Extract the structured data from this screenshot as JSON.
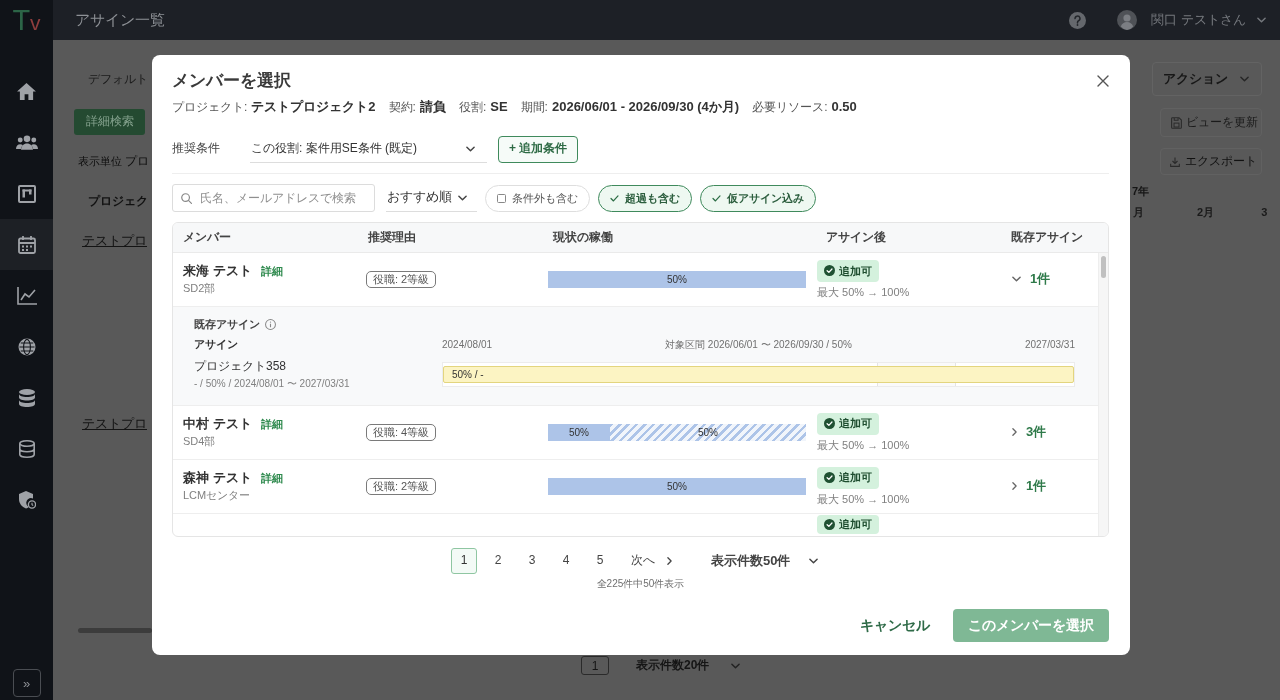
{
  "sidebar": {
    "logo": "Tv",
    "items": [
      {
        "selected": false
      },
      {
        "selected": false
      },
      {
        "selected": false
      },
      {
        "selected": true
      },
      {
        "selected": false
      },
      {
        "selected": false
      },
      {
        "selected": false
      },
      {
        "selected": false
      },
      {
        "selected": false
      }
    ],
    "expand_button": "»"
  },
  "header": {
    "title": "アサイン一覧",
    "user": "関口 テストさん"
  },
  "page": {
    "view": "デフォルト",
    "search_button": "詳細検索",
    "unit_label": "表示単位",
    "unit_value": "プロ",
    "column": "プロジェク",
    "links": [
      "テストプロ",
      "テストプロ"
    ],
    "action_menu": "アクション",
    "update_view": "ビューを更新",
    "export": "エクスポート",
    "year": "7年",
    "months": [
      "月",
      "2月",
      "3"
    ],
    "pagination": {
      "page": "1",
      "page_size": "表示件数20件"
    }
  },
  "dialog": {
    "title": "メンバーを選択",
    "meta": [
      {
        "label": "プロジェクト:",
        "value": "テストプロジェクト2"
      },
      {
        "label": "契約:",
        "value": "請負"
      },
      {
        "label": "役割:",
        "value": "SE"
      },
      {
        "label": "期間:",
        "value": "2026/06/01 - 2026/09/30 (4か月)"
      },
      {
        "label": "必要リソース:",
        "value": "0.50"
      }
    ],
    "criteria": {
      "label": "推奨条件",
      "value": "この役割: 案件用SE条件 (既定)",
      "add_button": "+ 追加条件"
    },
    "search": {
      "placeholder": "氏名、メールアドレスで検索"
    },
    "sort": "おすすめ順",
    "filters": [
      {
        "label": "条件外も含む",
        "checked": false
      },
      {
        "label": "超過も含む",
        "checked": true
      },
      {
        "label": "仮アサイン込み",
        "checked": true
      }
    ],
    "table": {
      "columns": [
        "メンバー",
        "推奨理由",
        "現状の稼働",
        "アサイン後",
        "既存アサイン"
      ],
      "rows": [
        {
          "name": "来海 テスト",
          "detail": "詳細",
          "department": "SD2部",
          "reason": "役職: 2等級",
          "workload": [
            {
              "kind": "solid",
              "level": 1,
              "label": "50%"
            }
          ],
          "status": "追加可",
          "capacity": "最大 50% → 100%",
          "expanded": true,
          "existing": "1件",
          "assignments": {
            "title": "既存アサイン",
            "column": "アサイン",
            "start": "2024/08/01",
            "target": "対象区間 2026/06/01 〜 2026/09/30 / 50%",
            "end": "2027/03/31",
            "items": [
              {
                "name": "プロジェクト358",
                "summary": "- / 50% / 2024/08/01 〜 2027/03/31",
                "bar": "50% / -"
              }
            ]
          }
        },
        {
          "name": "中村 テスト",
          "detail": "詳細",
          "department": "SD4部",
          "reason": "役職: 4等級",
          "workload": [
            {
              "kind": "solid",
              "level": 0.24,
              "label": "50%"
            },
            {
              "kind": "striped",
              "level": 0.76,
              "label": "50%"
            }
          ],
          "status": "追加可",
          "capacity": "最大 50% → 100%",
          "expanded": false,
          "existing": "3件"
        },
        {
          "name": "森神 テスト",
          "detail": "詳細",
          "department": "LCMセンター",
          "reason": "役職: 2等級",
          "workload": [
            {
              "kind": "solid",
              "level": 1,
              "label": "50%"
            }
          ],
          "status": "追加可",
          "capacity": "最大 50% → 100%",
          "expanded": false,
          "existing": "1件"
        },
        {
          "status": "追加可"
        }
      ]
    },
    "pagination": {
      "pages": [
        {
          "label": "1",
          "selected": true
        },
        {
          "label": "2",
          "selected": false
        },
        {
          "label": "3",
          "selected": false
        },
        {
          "label": "4",
          "selected": false
        },
        {
          "label": "5",
          "selected": false
        }
      ],
      "next": "次へ",
      "page_size": "表示件数50件",
      "summary": "全225件中50件表示"
    },
    "footer": {
      "cancel": "キャンセル",
      "confirm": {
        "label": "このメンバーを選択",
        "disabled": true
      }
    }
  }
}
